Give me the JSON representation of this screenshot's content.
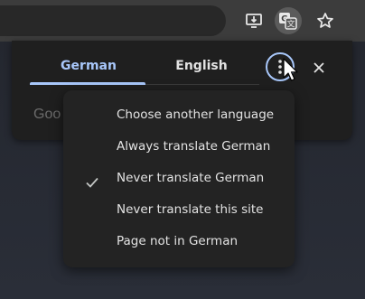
{
  "toolbar": {
    "icons": [
      "install-app-icon",
      "translate-icon",
      "bookmark-star-icon"
    ]
  },
  "translate_bubble": {
    "tabs": [
      {
        "label": "German",
        "selected": true
      },
      {
        "label": "English",
        "selected": false
      }
    ],
    "more_options_icon": "more-vert-icon",
    "close_icon": "close-icon",
    "partial_text": "Goo",
    "accent_color": "#a8c7fa"
  },
  "options_menu": {
    "items": [
      {
        "label": "Choose another language",
        "checked": false
      },
      {
        "label": "Always translate German",
        "checked": false
      },
      {
        "label": "Never translate German",
        "checked": true
      },
      {
        "label": "Never translate this site",
        "checked": false
      },
      {
        "label": "Page not in German",
        "checked": false
      }
    ]
  }
}
